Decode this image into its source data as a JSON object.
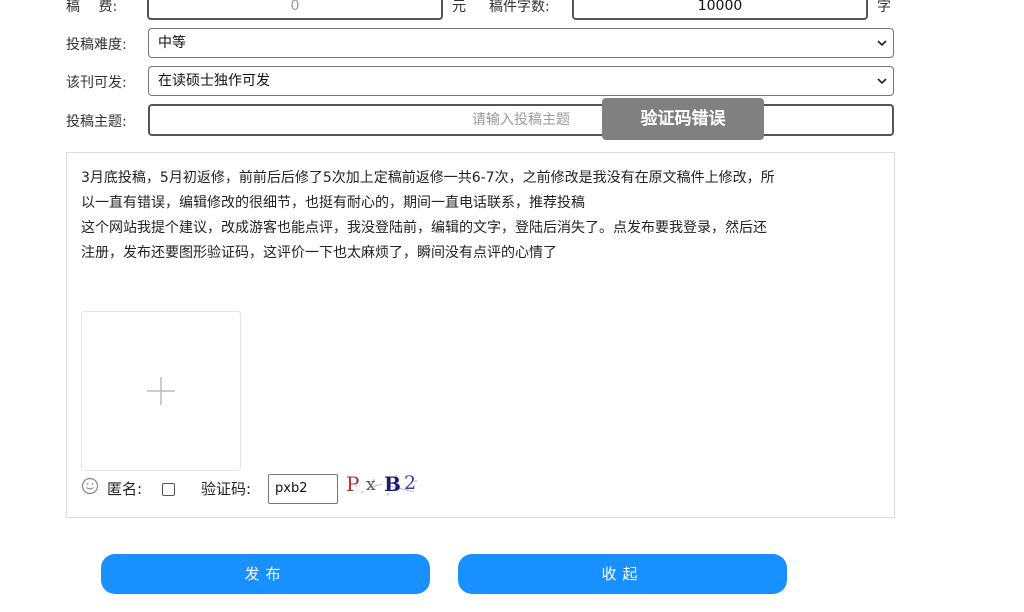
{
  "form": {
    "fee": {
      "label": "稿　 费:",
      "value": "0",
      "unit": "元"
    },
    "word_count": {
      "label": "稿件字数:",
      "value": "10000",
      "unit": "字"
    },
    "difficulty": {
      "label": "投稿难度:",
      "selected": "中等"
    },
    "publishable": {
      "label": "该刊可发:",
      "selected": "在读硕士独作可发"
    },
    "topic": {
      "label": "投稿主题:",
      "placeholder": "请输入投稿主题"
    }
  },
  "toast": {
    "text": "验证码错误"
  },
  "comment": {
    "lines": [
      "3月底投稿，5月初返修，前前后后修了5次加上定稿前返修一共6-7次，之前修改是我没有在原文稿件上修改，所",
      "以一直有错误，编辑修改的很细节，也挺有耐心的，期间一直电话联系，推荐投稿",
      "这个网站我提个建议，改成游客也能点评，我没登陆前，编辑的文字，登陆后消失了。点发布要我登录，然后还",
      "注册，发布还要图形验证码，这评价一下也太麻烦了，瞬间没有点评的心情了"
    ],
    "upload_symbol": "+",
    "anonymous_label": "匿名:",
    "captcha_label": "验证码:",
    "captcha_value": "pxb2",
    "captcha_chars": [
      "P",
      "x",
      "B",
      "2"
    ],
    "emoji_icon": "smile-icon"
  },
  "buttons": {
    "publish": "发布",
    "collapse": "收起"
  },
  "colors": {
    "primary": "#1890ff",
    "toast_bg": "#808080"
  }
}
